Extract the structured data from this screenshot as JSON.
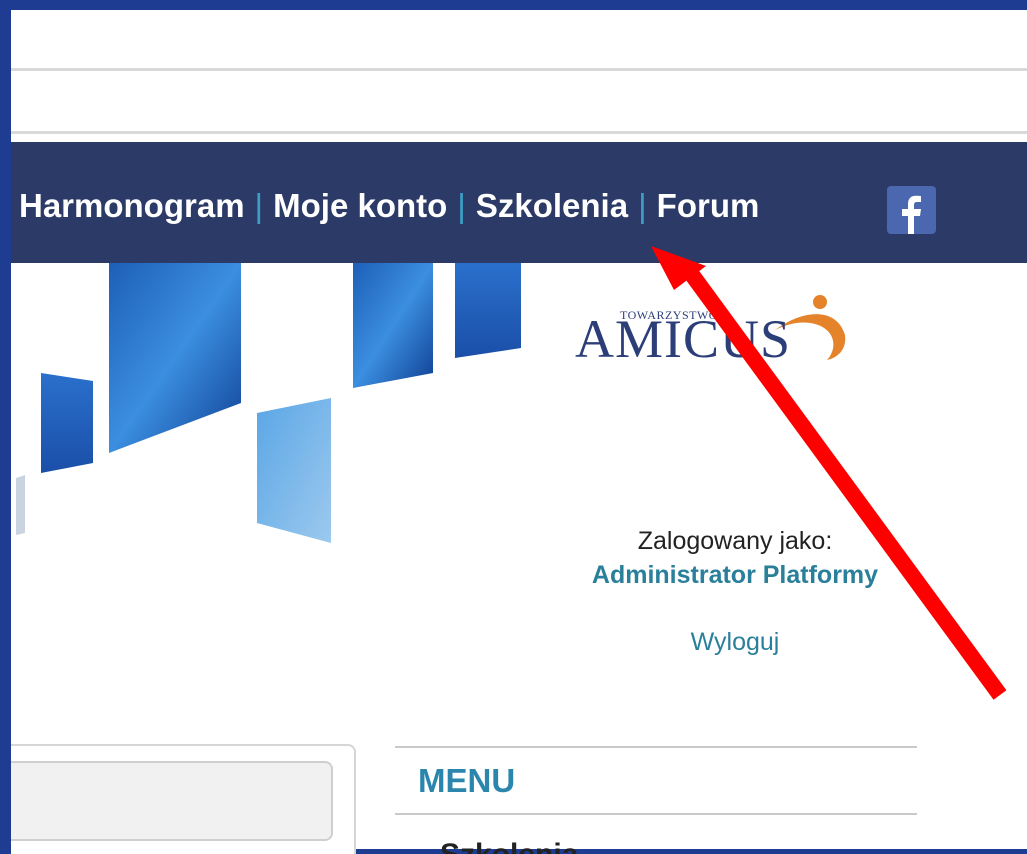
{
  "nav": {
    "items": [
      {
        "label": "Harmonogram"
      },
      {
        "label": "Moje konto"
      },
      {
        "label": "Szkolenia"
      },
      {
        "label": "Forum"
      }
    ],
    "separator": "|",
    "social_icon": "facebook-icon",
    "colors": {
      "background": "#2b3a66",
      "separator": "#3d9fc6",
      "text": "#ffffff"
    }
  },
  "logo": {
    "small_text": "TOWARZYSTWO",
    "main_text": "AMICUS",
    "color": "#2c3e78",
    "accent": "#e4832a"
  },
  "login": {
    "label": "Zalogowany jako:",
    "user": "Administrator Platformy",
    "logout": "Wyloguj",
    "link_color": "#2a7f9a"
  },
  "menu": {
    "title": "MENU",
    "first_item": "Szkolenia",
    "title_color": "#2a86ad"
  },
  "annotation": {
    "arrow_color": "#ff0000",
    "points_to": "Szkolenia"
  }
}
